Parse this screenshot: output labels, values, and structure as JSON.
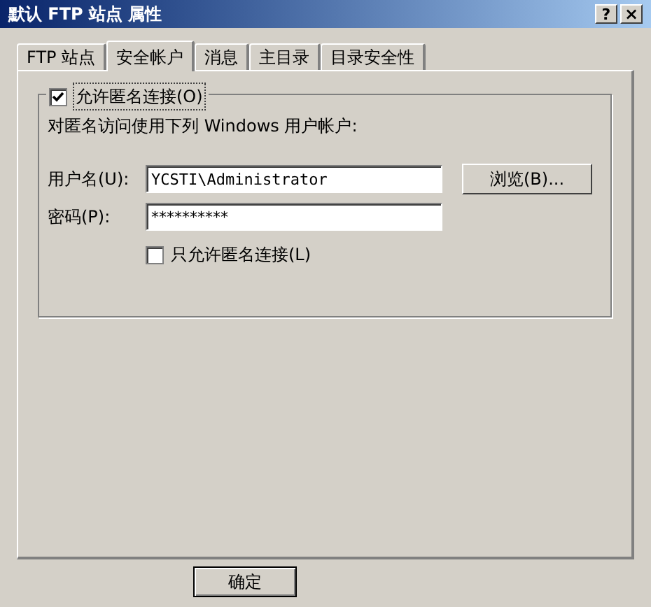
{
  "window": {
    "title": "默认 FTP 站点 属性",
    "help_button": "?",
    "close_button": "×"
  },
  "tabs": [
    {
      "label": "FTP 站点",
      "selected": false
    },
    {
      "label": "安全帐户",
      "selected": true
    },
    {
      "label": "消息",
      "selected": false
    },
    {
      "label": "主目录",
      "selected": false
    },
    {
      "label": "目录安全性",
      "selected": false
    }
  ],
  "anonymous_group": {
    "label": "允许匿名连接(O)",
    "checked": true,
    "description": "对匿名访问使用下列 Windows 用户帐户:",
    "username": {
      "label": "用户名(U):",
      "value": "YCSTI\\Administrator"
    },
    "browse_button": "浏览(B)...",
    "password": {
      "label": "密码(P):",
      "value": "**********"
    },
    "anonymous_only": {
      "label": "只允许匿名连接(L)",
      "checked": false
    }
  },
  "buttons": [
    "确定"
  ]
}
